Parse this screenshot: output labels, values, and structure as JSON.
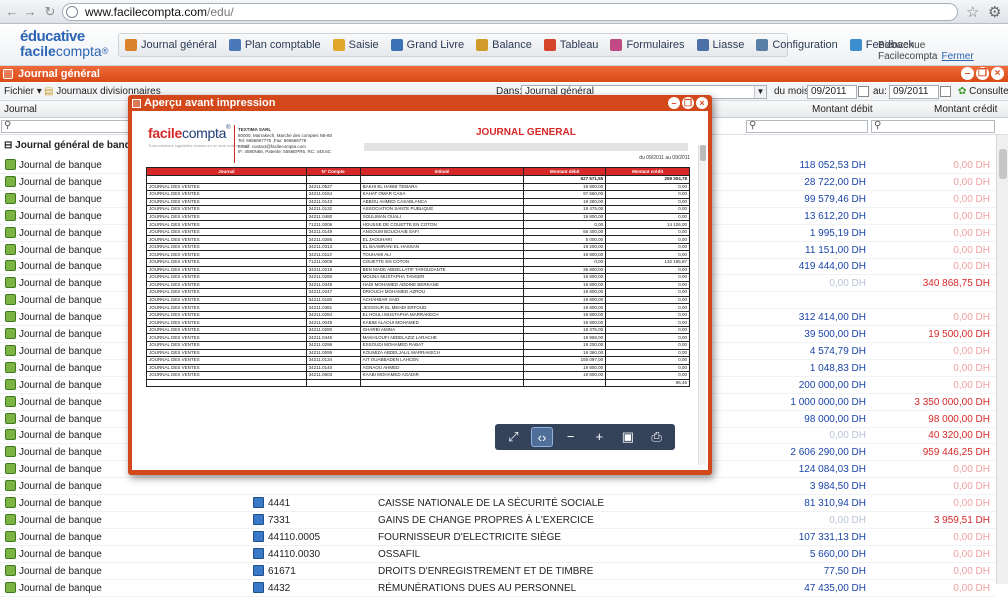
{
  "browser": {
    "url_domain": "www.facilecompta.com",
    "url_path": "/edu/"
  },
  "logo": {
    "line1": "éducative",
    "line2a": "facile",
    "line2b": "compta",
    "reg": "®"
  },
  "menu": [
    {
      "label": "Journal général",
      "icon": "journal-icon",
      "color": "#d9822b"
    },
    {
      "label": "Plan comptable",
      "icon": "plan-icon",
      "color": "#4a78b8"
    },
    {
      "label": "Saisie",
      "icon": "pencil-icon",
      "color": "#e0a82a"
    },
    {
      "label": "Grand Livre",
      "icon": "book-icon",
      "color": "#3a72b5"
    },
    {
      "label": "Balance",
      "icon": "balance-icon",
      "color": "#d19b2c"
    },
    {
      "label": "Tableau",
      "icon": "chart-icon",
      "color": "#d6452a"
    },
    {
      "label": "Formulaires",
      "icon": "forms-icon",
      "color": "#c24a86"
    },
    {
      "label": "Liasse",
      "icon": "liasse-icon",
      "color": "#4c6fa8"
    },
    {
      "label": "Configuration",
      "icon": "gear-icon",
      "color": "#5a7fa6"
    },
    {
      "label": "Feedback",
      "icon": "chat-icon",
      "color": "#3b8fd1"
    }
  ],
  "welcome": {
    "text": "Bienvenue Facilecompta",
    "logout": "Fermer"
  },
  "window": {
    "title": "Journal général"
  },
  "toolbar": {
    "fichier": "Fichier",
    "journaux": "Journaux divisionnaires",
    "dans_label": "Dans:",
    "dans_value": "Journal général",
    "du_label": "du mois:",
    "du_value": "09/2011",
    "au_label": "au:",
    "au_value": "09/2011",
    "consulter": "Consulter"
  },
  "columns": {
    "journal": "Journal",
    "debit": "Montant débit",
    "credit": "Montant crédit"
  },
  "group": {
    "label": "Journal général de banque : Se"
  },
  "rows": [
    {
      "journal": "Journal de banque",
      "debit": "118 052,53 DH",
      "credit": "0,00 DH"
    },
    {
      "journal": "Journal de banque",
      "debit": "28 722,00 DH",
      "credit": "0,00 DH"
    },
    {
      "journal": "Journal de banque",
      "debit": "99 579,46 DH",
      "credit": "0,00 DH"
    },
    {
      "journal": "Journal de banque",
      "debit": "13 612,20 DH",
      "credit": "0,00 DH"
    },
    {
      "journal": "Journal de banque",
      "debit": "1 995,19 DH",
      "credit": "0,00 DH"
    },
    {
      "journal": "Journal de banque",
      "debit": "11 151,00 DH",
      "credit": "0,00 DH"
    },
    {
      "journal": "Journal de banque",
      "debit": "419 444,00 DH",
      "credit": "0,00 DH"
    },
    {
      "journal": "Journal de banque",
      "debit": "0,00 DH",
      "credit": "340 868,75 DH",
      "debit_zero": true
    },
    {
      "journal": "Journal de banque",
      "debit": "",
      "credit": ""
    },
    {
      "journal": "Journal de banque",
      "debit": "312 414,00 DH",
      "credit": "0,00 DH"
    },
    {
      "journal": "Journal de banque",
      "debit": "39 500,00 DH",
      "credit": "19 500,00 DH"
    },
    {
      "journal": "Journal de banque",
      "debit": "4 574,79 DH",
      "credit": "0,00 DH"
    },
    {
      "journal": "Journal de banque",
      "debit": "1 048,83 DH",
      "credit": "0,00 DH"
    },
    {
      "journal": "Journal de banque",
      "debit": "200 000,00 DH",
      "credit": "0,00 DH"
    },
    {
      "journal": "Journal de banque",
      "debit": "1 000 000,00 DH",
      "credit": "3 350 000,00 DH"
    },
    {
      "journal": "Journal de banque",
      "debit": "98 000,00 DH",
      "credit": "98 000,00 DH"
    },
    {
      "journal": "Journal de banque",
      "debit": "0,00 DH",
      "credit": "40 320,00 DH",
      "debit_zero": true
    },
    {
      "journal": "Journal de banque",
      "debit": "2 606 290,00 DH",
      "credit": "959 446,25 DH"
    },
    {
      "journal": "Journal de banque",
      "debit": "124 084,03 DH",
      "credit": "0,00 DH"
    },
    {
      "journal": "Journal de banque",
      "debit": "3 984,50 DH",
      "credit": "0,00 DH"
    },
    {
      "journal": "Journal de banque",
      "code": "4441",
      "libelle": "CAISSE NATIONALE DE LA SÉCURITÉ SOCIALE",
      "debit": "81 310,94 DH",
      "credit": "0,00 DH"
    },
    {
      "journal": "Journal de banque",
      "code": "7331",
      "libelle": "GAINS DE CHANGE PROPRES À L'EXERCICE",
      "debit": "0,00 DH",
      "credit": "3 959,51 DH",
      "debit_zero": true
    },
    {
      "journal": "Journal de banque",
      "code": "44110.0005",
      "libelle": "FOURNISSEUR D'ELECTRICITE SIÈGE",
      "debit": "107 331,13 DH",
      "credit": "0,00 DH"
    },
    {
      "journal": "Journal de banque",
      "code": "44110.0030",
      "libelle": "OSSAFIL",
      "debit": "5 660,00 DH",
      "credit": "0,00 DH"
    },
    {
      "journal": "Journal de banque",
      "code": "61671",
      "libelle": "DROITS D'ENREGISTREMENT ET DE TIMBRE",
      "debit": "77,50 DH",
      "credit": "0,00 DH"
    },
    {
      "journal": "Journal de banque",
      "code": "4432",
      "libelle": "RÉMUNÉRATIONS DUES AU PERSONNEL",
      "debit": "47 435,00 DH",
      "credit": "0,00 DH"
    }
  ],
  "modal": {
    "title": "Aperçu avant impression",
    "report": {
      "logo_a": "facile",
      "logo_b": "compta",
      "reg": "®",
      "logo_sub": "Trois solutions logicielles réunies en un seul outil en ligne",
      "company_lines": [
        "TEXTIMA SARL",
        "80000, Marrakech, Marche des comptes N8-80",
        "Tel: 6666667775 ,Fax: 666666778",
        "Email: contact@facilecompta.com",
        "IF: 4590N56, Patente: 5556EPR6, RC: 448.6C"
      ],
      "title": "JOURNAL GENERAL",
      "period": "du 09/2011 au 09/2011",
      "headers": [
        "Journal",
        "N° Compte",
        "Intitulé",
        "Montant débit",
        "Montant crédit"
      ],
      "total": {
        "debit": "627 571,55",
        "credit": "259 304,78"
      },
      "lines": [
        [
          "JOURNAL DES VENTES",
          "34211.0527",
          "BAKHI EL HABIB TEMARA",
          "19 800,00",
          "0,00"
        ],
        [
          "JOURNAL DES VENTES",
          "34211.0164",
          "KAHAT OMAR CASA",
          "97 660,00",
          "0,00"
        ],
        [
          "JOURNAL DES VENTES",
          "34211.0143",
          "ABBOU AHMED CASABLANCA",
          "19 280,00",
          "0,00"
        ],
        [
          "JOURNAL DES VENTES",
          "34211.0132",
          "ASSOCIATION SANTE PUBLIQUE",
          "19 475,00",
          "0,00"
        ],
        [
          "JOURNAL DES VENTES",
          "34211.0480",
          "SOULIMAN OUALI",
          "19 800,00",
          "0,00"
        ],
        [
          "JOURNAL DES VENTES",
          "71211.0006",
          "HOUSSE DE COUETTE EN COTON",
          "0,00",
          "14 126,00"
        ],
        [
          "JOURNAL DES VENTES",
          "34211.0149",
          "ANGOUM BOUCHAIB SAFI",
          "56 400,00",
          "0,00"
        ],
        [
          "JOURNAL DES VENTES",
          "34211.0286",
          "EL JAOUHARI",
          "5 000,00",
          "0,00"
        ],
        [
          "JOURNAL DES VENTES",
          "34211.0313",
          "EL BAAMRANI EL HASSAN",
          "19 200,00",
          "0,00"
        ],
        [
          "JOURNAL DES VENTES",
          "34211.0113",
          "TOUHAMI ALI",
          "19 800,00",
          "0,00"
        ],
        [
          "JOURNAL DES VENTES",
          "71211.0009",
          "COUETTE EN COTON",
          "0,00",
          "132 185,87"
        ],
        [
          "JOURNAL DES VENTES",
          "34211.0219",
          "BEN MADE ABDELLATIF TAROUDANTE",
          "36 800,00",
          "0,00"
        ],
        [
          "JOURNAL DES VENTES",
          "34211.0250",
          "MOUNA MUSTAPHA TANGER",
          "19 800,00",
          "0,00"
        ],
        [
          "JOURNAL DES VENTES",
          "34211.0349",
          "HADI MOHAMED ADDINE BERKANE",
          "19 800,00",
          "0,00"
        ],
        [
          "JOURNAL DES VENTES",
          "34211.0247",
          "DRIOUCH MOHAMED AZROU",
          "19 800,00",
          "0,00"
        ],
        [
          "JOURNAL DES VENTES",
          "34211.0180",
          "ACHAHBAR SAID",
          "19 800,00",
          "0,00"
        ],
        [
          "JOURNAL DES VENTES",
          "34211.0381",
          "JESSOUR EL MEHDI ERFOUD",
          "19 800,00",
          "0,00"
        ],
        [
          "JOURNAL DES VENTES",
          "34211.0284",
          "EL HOULI MUSTAPHA MARRAKECH",
          "19 800,00",
          "0,00"
        ],
        [
          "JOURNAL DES VENTES",
          "34211.0049",
          "KABIM ALAOUI MOHAMED",
          "19 800,00",
          "0,00"
        ],
        [
          "JOURNAL DES VENTES",
          "34211.0280",
          "GHARBI AMINA",
          "19 376,00",
          "0,00"
        ],
        [
          "JOURNAL DES VENTES",
          "34211.0446",
          "MAKHLOUFI ABDELAZIZ LARACHE",
          "19 968,00",
          "0,00"
        ],
        [
          "JOURNAL DES VENTES",
          "34211.0296",
          "ESSOUDI MOHAMED RABAT",
          "19 200,00",
          "0,00"
        ],
        [
          "JOURNAL DES VENTES",
          "34211.0095",
          "KOUMIZA ABDELJALIL MARRAKECH",
          "19 360,00",
          "0,00"
        ],
        [
          "JOURNAL DES VENTES",
          "34211.0134",
          "AIT OUABBADEN LAHCEN",
          "155 097,00",
          "0,00"
        ],
        [
          "JOURNAL DES VENTES",
          "34211.0140",
          "AGNAOU AHMED",
          "19 800,00",
          "0,00"
        ],
        [
          "JOURNAL DES VENTES",
          "34211.0603",
          "KAABI MOHAMED AGADIR",
          "19 800,00",
          "0,00"
        ],
        [
          "",
          "",
          "",
          "",
          "96,45"
        ]
      ]
    },
    "tools": [
      {
        "icon": "fit-page-icon",
        "glyph": "⤢"
      },
      {
        "icon": "fit-width-icon",
        "glyph": "‹›"
      },
      {
        "icon": "zoom-out-icon",
        "glyph": "−"
      },
      {
        "icon": "zoom-in-icon",
        "glyph": "+"
      },
      {
        "icon": "save-icon",
        "glyph": "▣"
      },
      {
        "icon": "print-icon",
        "glyph": "⎙"
      }
    ]
  }
}
